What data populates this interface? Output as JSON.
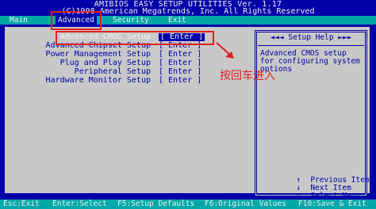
{
  "window": {
    "title": "AMIBIOS EASY SETUP UTILITIES Ver. 1.17",
    "copyright": "(C)1998 American Megatrends, Inc. All Rights Reserved"
  },
  "menu": {
    "tabs": [
      {
        "label": "Main"
      },
      {
        "label": "Advanced",
        "active": true
      },
      {
        "label": "Security"
      },
      {
        "label": "Exit"
      }
    ]
  },
  "setup_items": [
    {
      "label": "Advanced CMOS Setup",
      "value": "[ Enter ]",
      "selected": true
    },
    {
      "label": "Advanced Chipset Setup",
      "value": "[ Enter ]"
    },
    {
      "label": "Power Management Setup",
      "value": "[ Enter ]"
    },
    {
      "label": "Plug and Play Setup",
      "value": "[ Enter ]"
    },
    {
      "label": "Peripheral Setup",
      "value": "[ Enter ]"
    },
    {
      "label": "Hardware Monitor Setup",
      "value": "[ Enter ]"
    }
  ],
  "help": {
    "title": "◄◄◄ Setup Help ►►►",
    "lines": [
      "Advanced CMOS setup",
      "for configuring system",
      "options"
    ],
    "legend": [
      {
        "symbol": "↑",
        "text": "Previous Item"
      },
      {
        "symbol": "↓",
        "text": "Next Item"
      },
      {
        "symbol": "↔",
        "text": "Select Menu"
      }
    ]
  },
  "footer_keys": [
    {
      "label": "Esc:Exit"
    },
    {
      "label": "Enter:Select"
    },
    {
      "label": "F5:Setup Defaults"
    },
    {
      "label": "F6:Original Values"
    },
    {
      "label": "F10:Save & Exit"
    }
  ],
  "annotation": {
    "text": "按回车进入",
    "color": "#e02020"
  },
  "colors": {
    "bios_blue": "#0000a8",
    "bios_cyan": "#00a8a8",
    "bios_gray": "#c8c8c8",
    "text_white": "#f0f0f0",
    "annotation_red": "#e02020"
  }
}
